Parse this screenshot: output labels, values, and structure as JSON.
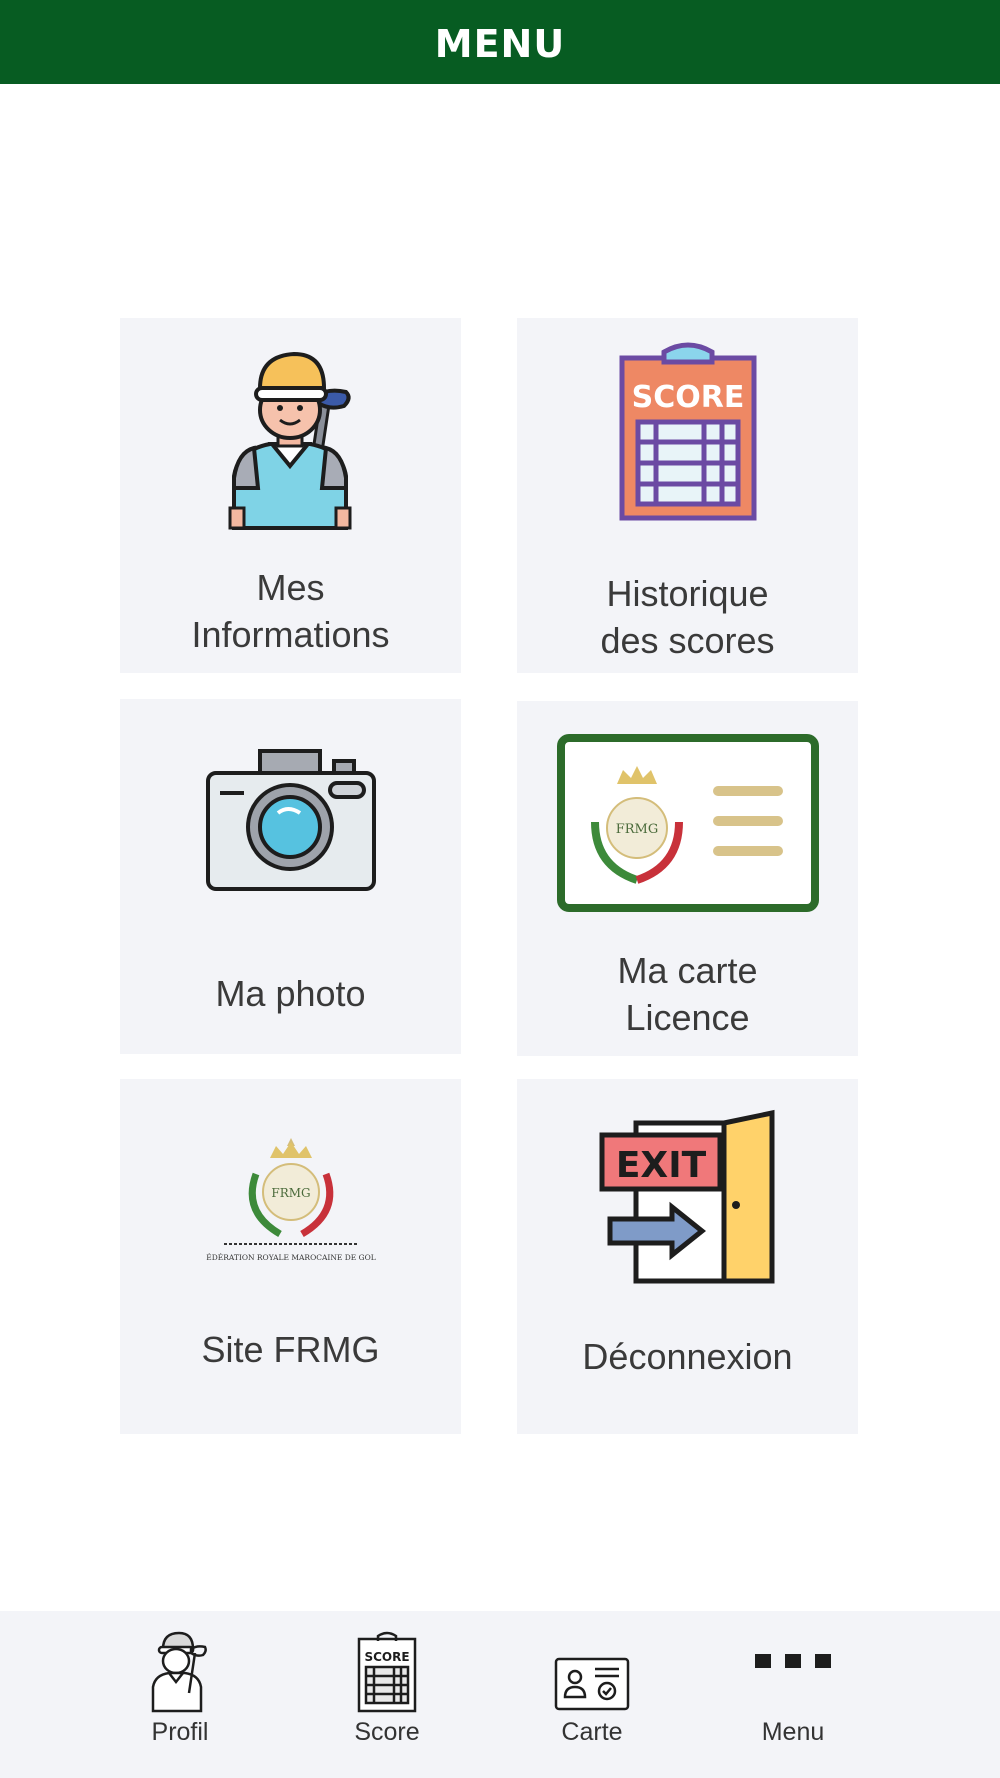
{
  "header": {
    "title": "MENU"
  },
  "colors": {
    "header_bg": "#075c22",
    "tile_bg": "#f3f4f8",
    "card_border": "#2c6b2a",
    "text": "#3a3a3a"
  },
  "tiles": [
    {
      "icon": "golfer-icon",
      "line1": "Mes",
      "line2": "Informations"
    },
    {
      "icon": "scorecard-icon",
      "line1": "Historique",
      "line2": "des scores"
    },
    {
      "icon": "camera-icon",
      "line1": "Ma photo"
    },
    {
      "icon": "license-card-icon",
      "line1": "Ma carte",
      "line2": "Licence",
      "logo_text": "FRMG"
    },
    {
      "icon": "frmg-logo-icon",
      "line1": "Site FRMG",
      "logo_text": "FRMG",
      "logo_caption": "FÉDÉRATION ROYALE MAROCAINE DE GOLF"
    },
    {
      "icon": "exit-door-icon",
      "line1": "Déconnexion",
      "sign_text": "EXIT"
    }
  ],
  "scorecard_text": "SCORE",
  "tabbar": [
    {
      "icon": "golfer-outline-icon",
      "label": "Profil"
    },
    {
      "icon": "scorecard-outline-icon",
      "label": "Score",
      "icon_text": "SCORE"
    },
    {
      "icon": "id-card-icon",
      "label": "Carte"
    },
    {
      "icon": "more-dots-icon",
      "label": "Menu"
    }
  ]
}
